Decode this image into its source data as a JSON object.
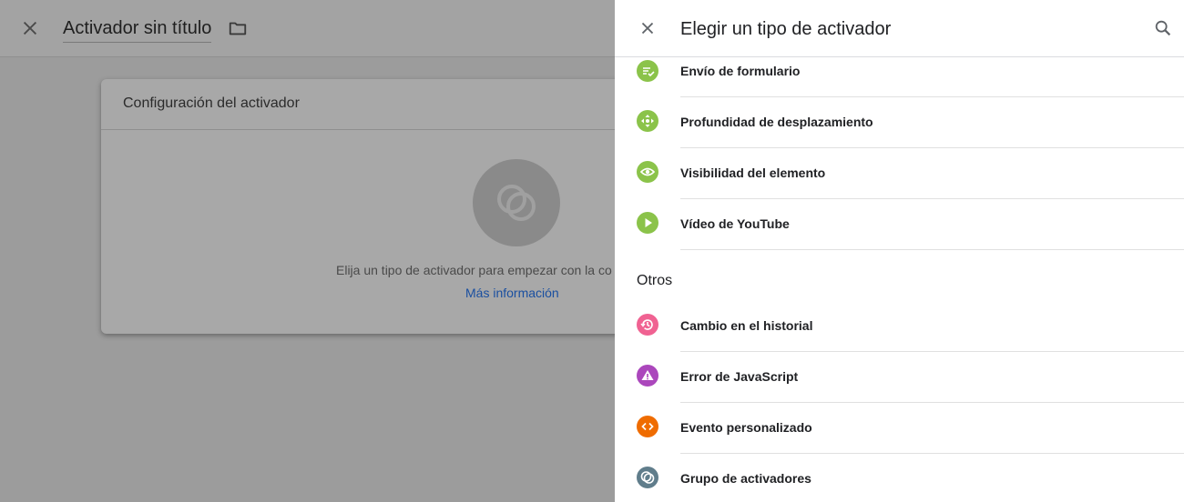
{
  "editor": {
    "title": "Activador sin título",
    "card": {
      "title": "Configuración del activador",
      "hint": "Elija un tipo de activador para empezar con la co",
      "link": "Más información"
    }
  },
  "panel": {
    "title": "Elegir un tipo de activador",
    "items_top": [
      {
        "label": "Envío de formulario",
        "icon": "form-submit-icon",
        "color": "#8bc34a"
      },
      {
        "label": "Profundidad de desplazamiento",
        "icon": "scroll-depth-icon",
        "color": "#8bc34a"
      },
      {
        "label": "Visibilidad del elemento",
        "icon": "visibility-icon",
        "color": "#8bc34a"
      },
      {
        "label": "Vídeo de YouTube",
        "icon": "play-icon",
        "color": "#8bc34a"
      }
    ],
    "section_other": "Otros",
    "items_other": [
      {
        "label": "Cambio en el historial",
        "icon": "history-icon",
        "color": "#f06292"
      },
      {
        "label": "Error de JavaScript",
        "icon": "warning-icon",
        "color": "#ab47bc"
      },
      {
        "label": "Evento personalizado",
        "icon": "code-icon",
        "color": "#ef6c00"
      },
      {
        "label": "Grupo de activadores",
        "icon": "trigger-group-icon",
        "color": "#607d8b"
      }
    ]
  }
}
